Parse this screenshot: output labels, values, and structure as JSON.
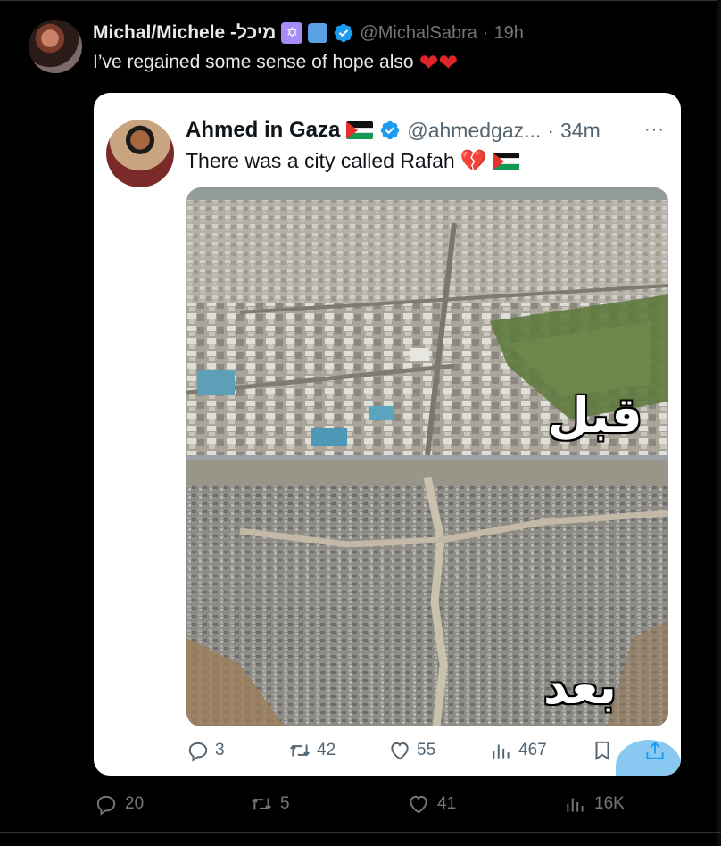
{
  "tweet": {
    "author_name": "Michal/Michele -מיכל",
    "emojis": [
      "star-of-david-emoji",
      "blue-square-emoji"
    ],
    "handle": "@MichalSabra",
    "separator": "·",
    "time": "19h",
    "text": "I’ve regained some sense of hope also",
    "text_emojis": "❤❤",
    "stats": {
      "replies": "20",
      "retweets": "5",
      "likes": "41",
      "views": "16K"
    }
  },
  "quoted": {
    "author_name": "Ahmed in Gaza",
    "handle": "@ahmedgaz...",
    "separator": "·",
    "time": "34m",
    "more": "···",
    "text": "There was a city called Rafah",
    "text_emoji": "💔",
    "image": {
      "top_label": "قبل",
      "bottom_label": "بعد"
    },
    "stats": {
      "replies": "3",
      "retweets": "42",
      "likes": "55",
      "views": "467"
    }
  },
  "colors": {
    "background": "#000000",
    "verified": "#1d9bf0",
    "heart": "#e0242c",
    "muted_dark": "#71767b",
    "muted_light": "#536471"
  }
}
